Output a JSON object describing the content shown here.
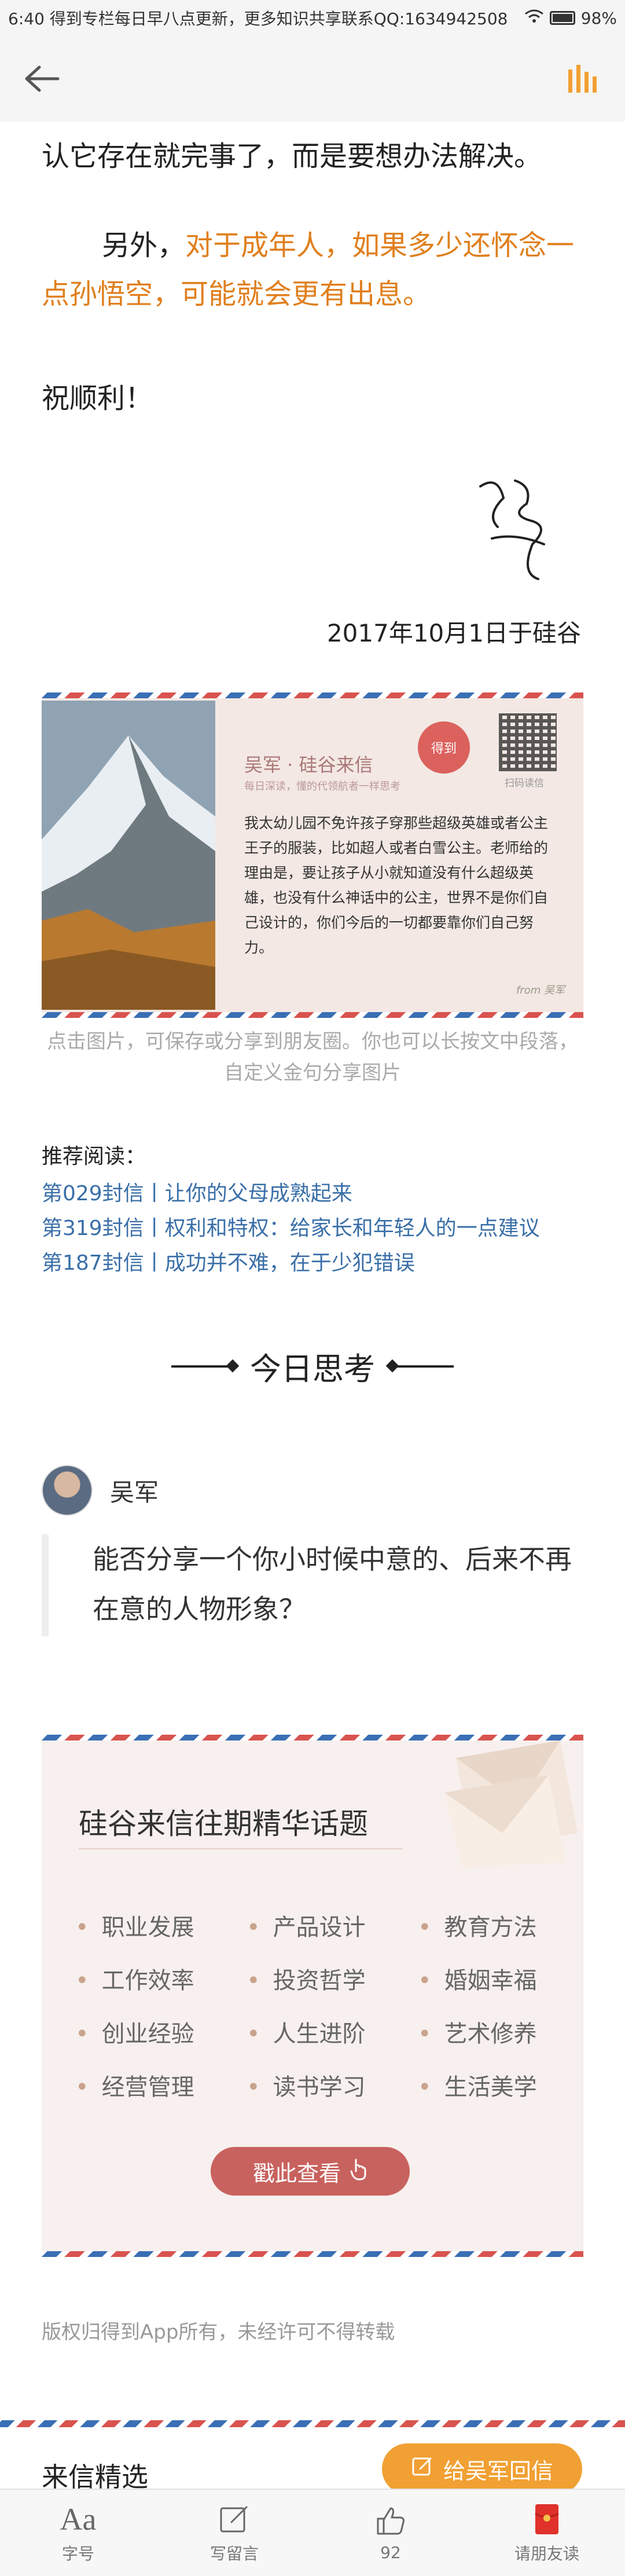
{
  "status_bar": {
    "time": "6:40",
    "notice": "得到专栏每日早八点更新，更多知识共享联系QQ:1634942508",
    "battery": "98%"
  },
  "article": {
    "para1": "认它存在就完事了，而是要想办法解决。",
    "para2_lead": "另外，",
    "para2_highlight": "对于成年人，如果多少还怀念一点孙悟空，可能就会更有出息。",
    "closing": "祝顺利！",
    "date": "2017年10月1日于硅谷"
  },
  "card": {
    "title": "吴军 · 硅谷来信",
    "subtitle": "每日深读，懂的代领航者一样思考",
    "stamp": "得到",
    "qr_label": "扫码读信",
    "body": "我太幼儿园不免许孩子穿那些超级英雄或者公主王子的服装，比如超人或者白雪公主。老师给的理由是，要让孩子从小就知道没有什么超级英雄，也没有什么神话中的公主，世界不是你们自己设计的，你们今后的一切都要靠你们自己努力。",
    "author": "from 吴军",
    "caption": "点击图片，可保存或分享到朋友圈。你也可以长按文中段落，自定义金句分享图片"
  },
  "recommended": {
    "title": "推荐阅读：",
    "links": [
      "第029封信丨让你的父母成熟起来",
      "第319封信丨权利和特权：给家长和年轻人的一点建议",
      "第187封信丨成功并不难，在于少犯错误"
    ]
  },
  "thinking": {
    "header": "今日思考",
    "author": "吴军",
    "question": "能否分享一个你小时候中意的、后来不再在意的人物形象？"
  },
  "topics": {
    "title": "硅谷来信往期精华话题",
    "items": [
      "职业发展",
      "产品设计",
      "教育方法",
      "工作效率",
      "投资哲学",
      "婚姻幸福",
      "创业经验",
      "人生进阶",
      "艺术修养",
      "经营管理",
      "读书学习",
      "生活美学"
    ],
    "button": "戳此查看"
  },
  "copyright": "版权归得到App所有，未经许可不得转载",
  "letters": {
    "title": "来信精选",
    "reply_button": "给吴军回信"
  },
  "toolbar": {
    "font_label": "字号",
    "comment_label": "写留言",
    "like_count": "92",
    "invite_label": "请朋友读"
  },
  "colors": {
    "accent_orange": "#e07f1d",
    "link_blue": "#3a6fa8",
    "reply_button": "#f1a033",
    "view_button": "#c8625e"
  }
}
